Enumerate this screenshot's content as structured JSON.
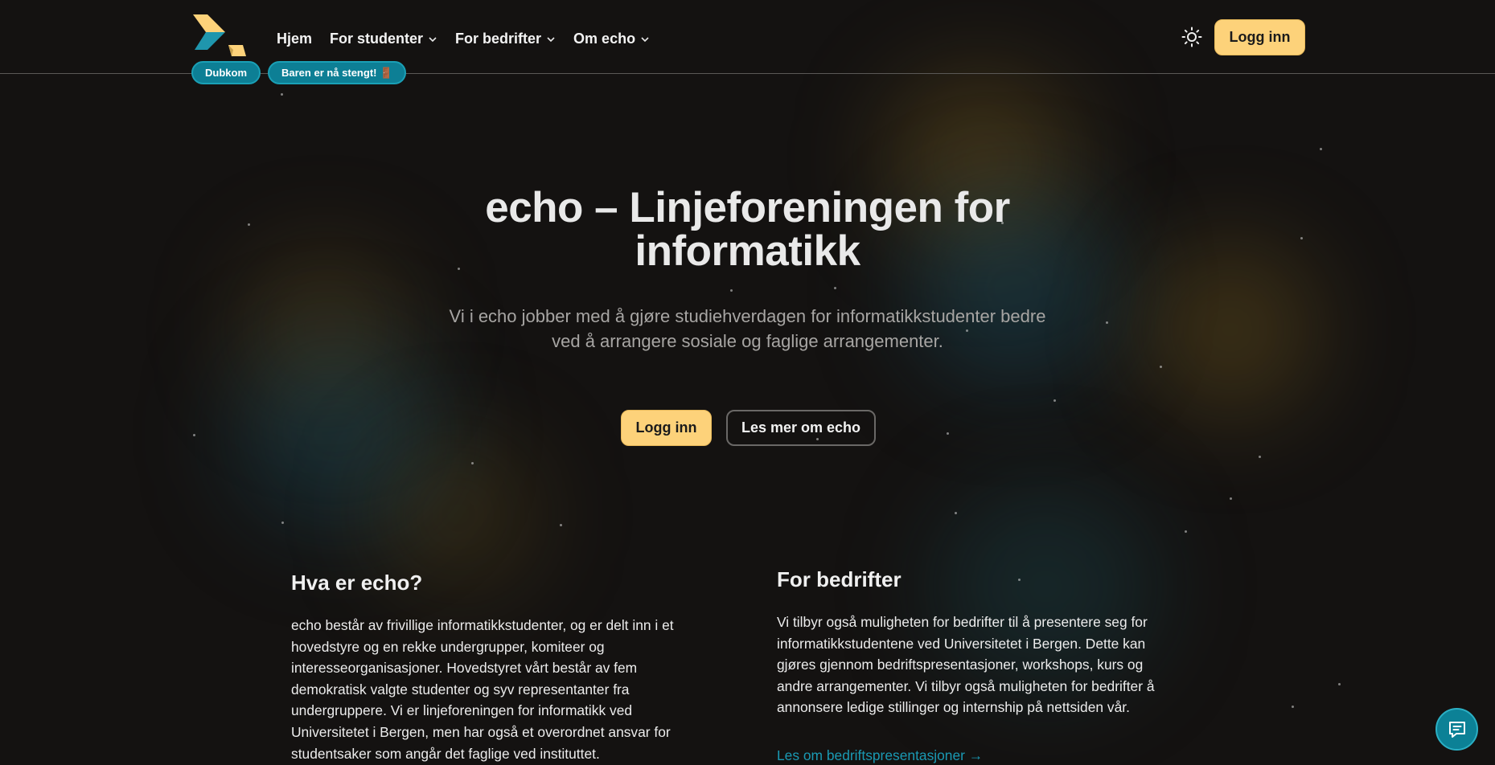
{
  "header": {
    "logo_alt": "echo logo",
    "nav": [
      {
        "label": "Hjem",
        "has_dropdown": false
      },
      {
        "label": "For studenter",
        "has_dropdown": true
      },
      {
        "label": "For bedrifter",
        "has_dropdown": true
      },
      {
        "label": "Om echo",
        "has_dropdown": true
      }
    ],
    "pills": [
      "Dubkom",
      "Baren er nå stengt! 🚪"
    ],
    "theme_icon": "sun-icon",
    "login_label": "Logg inn"
  },
  "hero": {
    "title_line1": "echo – Linjeforeningen for",
    "title_line2": "informatikk",
    "subtitle_line1": "Vi i echo jobber med å gjøre studiehverdagen for informatikkstudenter bedre",
    "subtitle_line2": "ved å arrangere sosiale og faglige arrangementer.",
    "cta_login": "Logg inn",
    "cta_more": "Les mer om echo"
  },
  "about": {
    "heading": "Hva er echo?",
    "lines": [
      "echo består av frivillige informatikkstudenter, og er delt inn i et",
      "hovedstyre og en rekke undergrupper, komiteer og",
      "interesseorganisasjoner. Hovedstyret vårt består av fem",
      "demokratisk valgte studenter og syv representanter fra",
      "undergruppere. Vi er linjeforeningen for informatikk ved",
      "Universitetet i Bergen, men har også et overordnet ansvar for",
      "studentsaker som angår det faglige ved instituttet."
    ]
  },
  "companies": {
    "heading": "For bedrifter",
    "lines": [
      "Vi tilbyr også muligheten for bedrifter til å presentere seg for",
      "informatikkstudentene ved Universitetet i Bergen. Dette kan",
      "gjøres gjennom bedriftspresentasjoner, workshops, kurs og",
      "andre arrangementer. Vi tilbyr også muligheten for bedrifter å",
      "annonsere ledige stillinger og internship på nettsiden vår."
    ],
    "link": "Les om bedriftspresentasjoner →"
  },
  "chat_icon": "chat-icon",
  "colors": {
    "background": "#141211",
    "accent_yellow": "#fdd27a",
    "accent_teal": "#0d7f95",
    "link": "#1a99b3"
  }
}
